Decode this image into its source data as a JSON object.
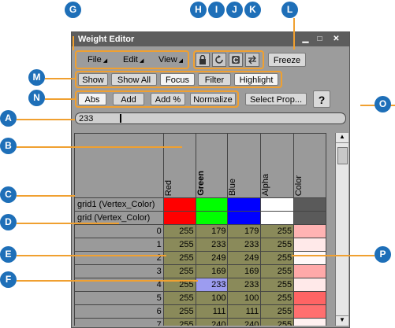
{
  "window": {
    "title": "Weight Editor"
  },
  "menus": [
    {
      "label": "File"
    },
    {
      "label": "Edit"
    },
    {
      "label": "View"
    }
  ],
  "toolbar": {
    "freeze": "Freeze"
  },
  "filter_buttons": [
    {
      "label": "Show"
    },
    {
      "label": "Show All"
    },
    {
      "label": "Focus"
    },
    {
      "label": "Filter"
    },
    {
      "label": "Highlight"
    }
  ],
  "mode_buttons": [
    {
      "label": "Abs"
    },
    {
      "label": "Add"
    },
    {
      "label": "Add %"
    },
    {
      "label": "Normalize"
    }
  ],
  "select_prop": "Select Prop...",
  "help": "?",
  "value_slider": {
    "value": "233"
  },
  "grid": {
    "columns": [
      "Red",
      "Green",
      "Blue",
      "Alpha",
      "Color"
    ],
    "groups": [
      {
        "label": "grid1 (Vertex_Color)",
        "swatches": [
          "#ff0000",
          "#00ff00",
          "#0000ff",
          "#ffffff",
          "#5a5a5a"
        ]
      },
      {
        "label": "grid (Vertex_Color)",
        "swatches": [
          "#ff0000",
          "#00ff00",
          "#0000ff",
          "#ffffff",
          "#5a5a5a"
        ]
      }
    ],
    "rows": [
      {
        "index": "0",
        "r": "255",
        "g": "179",
        "b": "179",
        "a": "255",
        "color": "#ffb3b3"
      },
      {
        "index": "1",
        "r": "255",
        "g": "233",
        "b": "233",
        "a": "255",
        "color": "#ffe9e9"
      },
      {
        "index": "2",
        "r": "255",
        "g": "249",
        "b": "249",
        "a": "255",
        "color": "#fff9f9"
      },
      {
        "index": "3",
        "r": "255",
        "g": "169",
        "b": "169",
        "a": "255",
        "color": "#ffa9a9"
      },
      {
        "index": "4",
        "r": "255",
        "g": "233",
        "b": "233",
        "a": "255",
        "color": "#ffe9e9"
      },
      {
        "index": "5",
        "r": "255",
        "g": "100",
        "b": "100",
        "a": "255",
        "color": "#ff6464"
      },
      {
        "index": "6",
        "r": "255",
        "g": "111",
        "b": "111",
        "a": "255",
        "color": "#ff6f6f"
      },
      {
        "index": "7",
        "r": "255",
        "g": "240",
        "b": "240",
        "a": "255",
        "color": "#fff0f0"
      }
    ],
    "highlight_cell_fill": "#9c9cf0"
  },
  "markers": [
    "A",
    "B",
    "C",
    "D",
    "E",
    "F",
    "G",
    "H",
    "I",
    "J",
    "K",
    "L",
    "M",
    "N",
    "O",
    "P"
  ],
  "colors": {
    "marker": "#1e6fb8",
    "leader": "#f0a030"
  }
}
